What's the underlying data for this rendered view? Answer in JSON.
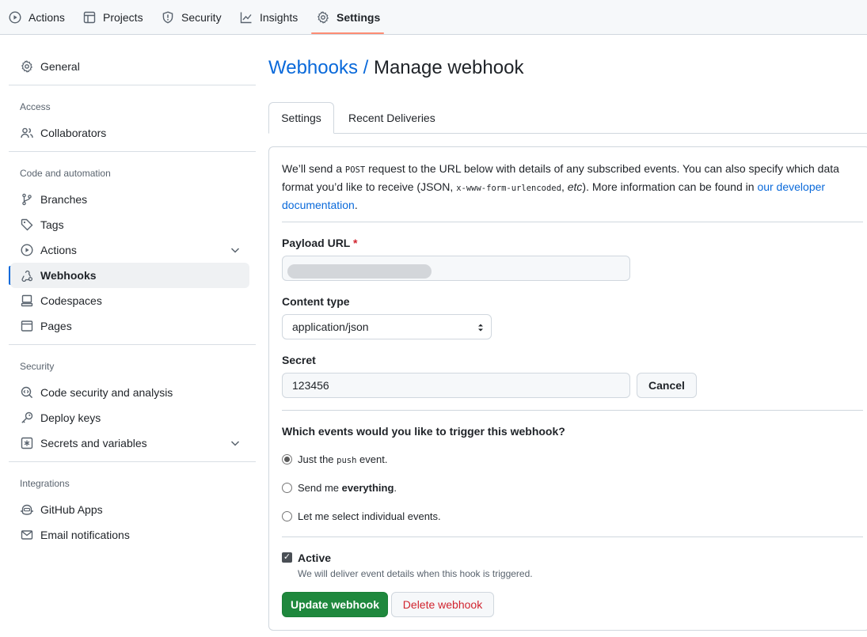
{
  "topnav": {
    "items": [
      {
        "label": "Actions",
        "icon": "play-circle-icon"
      },
      {
        "label": "Projects",
        "icon": "table-icon"
      },
      {
        "label": "Security",
        "icon": "shield-icon"
      },
      {
        "label": "Insights",
        "icon": "graph-icon"
      },
      {
        "label": "Settings",
        "icon": "gear-icon",
        "active": true
      }
    ]
  },
  "sidebar": {
    "general": "General",
    "sections": {
      "access": "Access",
      "code_automation": "Code and automation",
      "security": "Security",
      "integrations": "Integrations"
    },
    "items": {
      "collaborators": "Collaborators",
      "branches": "Branches",
      "tags": "Tags",
      "actions": "Actions",
      "webhooks": "Webhooks",
      "codespaces": "Codespaces",
      "pages": "Pages",
      "code_security": "Code security and analysis",
      "deploy_keys": "Deploy keys",
      "secrets": "Secrets and variables",
      "github_apps": "GitHub Apps",
      "email_notifications": "Email notifications"
    }
  },
  "main": {
    "breadcrumb": "Webhooks /",
    "title": "Manage webhook",
    "tabs": [
      "Settings",
      "Recent Deliveries"
    ],
    "intro": {
      "part1": "We’ll send a ",
      "post": "POST",
      "part2": " request to the URL below with details of any subscribed events. You can also specify which data format you’d like to receive (JSON, ",
      "urlencoded": "x-www-form-urlencoded",
      "part3": ", ",
      "etc": "etc",
      "part4": "). More information can be found in ",
      "link": "our developer documentation",
      "part5": "."
    },
    "payload_label": "Payload URL",
    "required_mark": "*",
    "content_type_label": "Content type",
    "content_type_value": "application/json",
    "secret_label": "Secret",
    "secret_value": "123456",
    "cancel_label": "Cancel",
    "events_question": "Which events would you like to trigger this webhook?",
    "event_options": {
      "push": {
        "pre": "Just the ",
        "code": "push",
        "post": " event.",
        "selected": true
      },
      "everything": {
        "pre": "Send me ",
        "bold": "everything",
        "post": ".",
        "selected": false
      },
      "individual": {
        "label": "Let me select individual events.",
        "selected": false
      }
    },
    "active_label": "Active",
    "active_checked": true,
    "active_note": "We will deliver event details when this hook is triggered.",
    "update_button": "Update webhook",
    "delete_button": "Delete webhook"
  },
  "colors": {
    "accent_link": "#0969da",
    "primary_button": "#1f883d",
    "danger_text": "#d1242f",
    "tab_underline": "#fd8c73"
  }
}
